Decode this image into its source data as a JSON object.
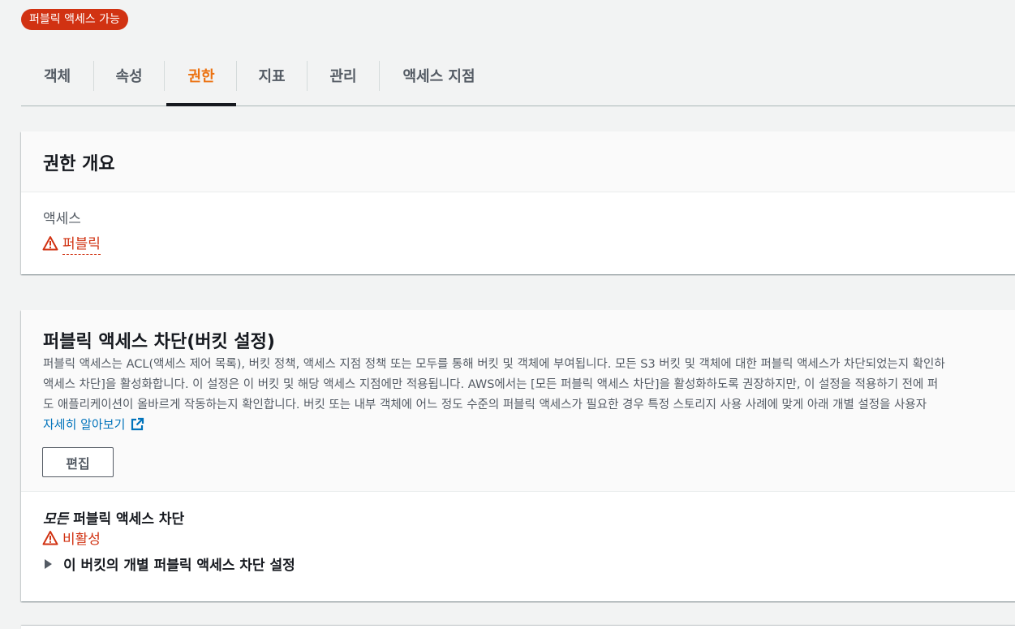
{
  "header": {
    "badge_label": "퍼블릭 액세스 가능"
  },
  "tabs": [
    {
      "label": "객체",
      "active": false
    },
    {
      "label": "속성",
      "active": false
    },
    {
      "label": "권한",
      "active": true
    },
    {
      "label": "지표",
      "active": false
    },
    {
      "label": "관리",
      "active": false
    },
    {
      "label": "액세스 지점",
      "active": false
    }
  ],
  "permissions_overview": {
    "title": "권한 개요",
    "access_label": "액세스",
    "access_value": "퍼블릭",
    "access_icon": "warning-icon"
  },
  "block_public_access": {
    "title": "퍼블릭 액세스 차단(버킷 설정)",
    "description_lines": [
      "퍼블릭 액세스는 ACL(액세스 제어 목록), 버킷 정책, 액세스 지점 정책 또는 모두를 통해 버킷 및 객체에 부여됩니다. 모든 S3 버킷 및 객체에 대한 퍼블릭 액세스가 차단되었는지 확인하",
      "액세스 차단]을 활성화합니다. 이 설정은 이 버킷 및 해당 액세스 지점에만 적용됩니다. AWS에서는 [모든 퍼블릭 액세스 차단]을 활성화하도록 권장하지만, 이 설정을 적용하기 전에 퍼",
      "도 애플리케이션이 올바르게 작동하는지 확인합니다. 버킷 또는 내부 객체에 어느 정도 수준의 퍼블릭 액세스가 필요한 경우 특정 스토리지 사용 사례에 맞게 아래 개별 설정을 사용자"
    ],
    "learn_more_link": "자세히 알아보기",
    "edit_button": "편집",
    "all_label_emphasis": "모든",
    "all_label_rest": "퍼블릭 액세스 차단",
    "all_status": "비활성",
    "expander_label": "이 버킷의 개별 퍼블릭 액세스 차단 설정"
  },
  "colors": {
    "accent_orange": "#ec7211",
    "danger_red": "#d13212",
    "link_blue": "#0073bb"
  }
}
